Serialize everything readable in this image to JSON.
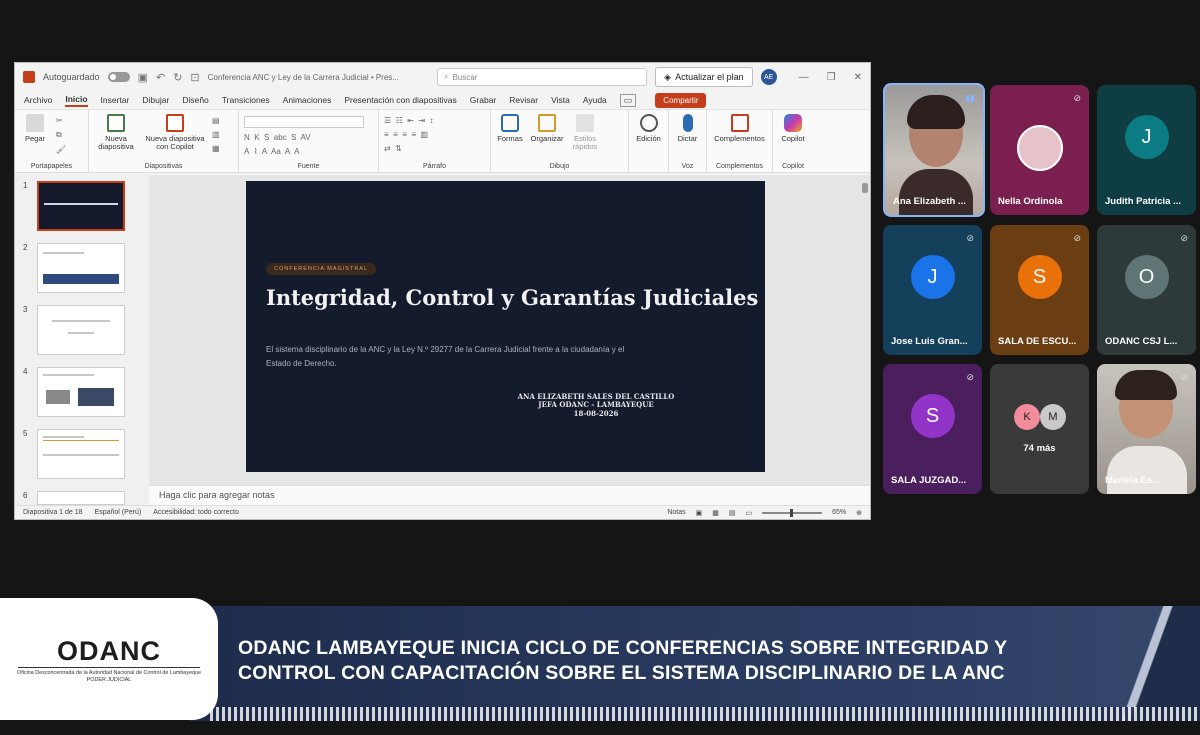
{
  "ppt": {
    "autosave_label": "Autoguardado",
    "doc_title": "Conferencia ANC y Ley de la Carrera Judicial  •  Pres...",
    "search_placeholder": "Buscar",
    "upgrade_label": "Actualizar el plan",
    "avatar_initials": "AE",
    "tabs": [
      "Archivo",
      "Inicio",
      "Insertar",
      "Dibujar",
      "Diseño",
      "Transiciones",
      "Animaciones",
      "Presentación con diapositivas",
      "Grabar",
      "Revisar",
      "Vista",
      "Ayuda"
    ],
    "active_tab": "Inicio",
    "share_label": "Compartir",
    "ribbon": {
      "paste": "Pegar",
      "new_slide": "Nueva diapositiva",
      "copilot_slide": "Nueva diapositiva con Copilot",
      "shapes": "Formas",
      "arrange": "Organizar",
      "quick_styles": "Estilos rápidos",
      "editing": "Edición",
      "dictate": "Dictar",
      "addins": "Complementos",
      "copilot": "Copilot",
      "groups": [
        "Portapapeles",
        "Diapositivas",
        "Fuente",
        "Párrafo",
        "Dibujo",
        "Voz",
        "Complementos",
        "Copilot"
      ]
    },
    "thumb_numbers": [
      "1",
      "2",
      "3",
      "4",
      "5",
      "6"
    ],
    "slide": {
      "badge": "CONFERENCIA MAGISTRAL",
      "title": "Integridad, Control y Garantías Judiciales",
      "subtitle": "El sistema disciplinario de la ANC y la Ley N.º 29277 de la Carrera Judicial frente a la ciudadanía y el Estado de Derecho.",
      "author_line1": "ANA ELIZABETH SALES DEL CASTILLO",
      "author_line2": "JEFA ODANC - LAMBAYEQUE",
      "author_date": "18-08-2026"
    },
    "notes_placeholder": "Haga clic para agregar notas",
    "status": {
      "slide_count": "Diapositiva 1 de 18",
      "language": "Español (Perú)",
      "accessibility": "Accesibilidad: todo correcto",
      "notes": "Notas",
      "zoom": "65%"
    }
  },
  "participants": [
    {
      "name": "Ana Elizabeth ...",
      "type": "video"
    },
    {
      "name": "Nella Ordinola",
      "type": "photo"
    },
    {
      "name": "Judith Patricia ...",
      "initial": "J",
      "bg": "#0f3d44",
      "circle": "#0c7c84"
    },
    {
      "name": "Jose Luis Gran...",
      "initial": "J",
      "bg": "#14405c",
      "circle": "#1a73e8"
    },
    {
      "name": "SALA DE ESCU...",
      "initial": "S",
      "bg": "#6b3d12",
      "circle": "#e8710a"
    },
    {
      "name": "ODANC CSJ L...",
      "initial": "O",
      "bg": "#2e3a3a",
      "circle": "#5f7474"
    },
    {
      "name": "SALA JUZGAD...",
      "initial": "S",
      "bg": "#4b1f5e",
      "circle": "#9334c9"
    },
    {
      "name": "74 más",
      "k": "K",
      "m": "M"
    },
    {
      "name": "Mariela Es...",
      "type": "video"
    }
  ],
  "lower_third": {
    "logo": "ODANC",
    "logo_sub": "Oficina Desconcentrada de la Autoridad Nacional de Control de Lambayeque",
    "logo_sub2": "PODER JUDICIAL",
    "headline_line1": "ODANC LAMBAYEQUE INICIA CICLO DE CONFERENCIAS SOBRE INTEGRIDAD Y",
    "headline_line2": "CONTROL CON CAPACITACIÓN SOBRE EL SISTEMA DISCIPLINARIO DE LA ANC"
  }
}
